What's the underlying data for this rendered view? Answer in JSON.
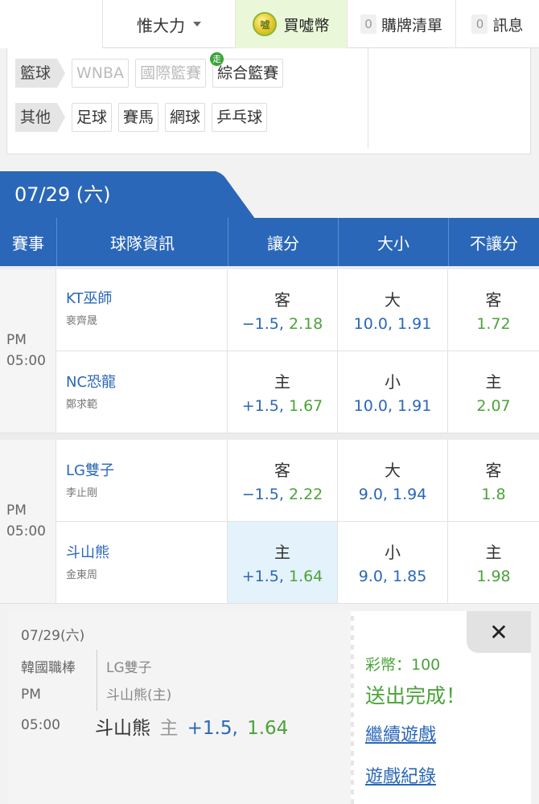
{
  "topbar": {
    "user_name": "惟大力",
    "coin_button_label": "買噓幣",
    "coin_icon_text": "噓",
    "cart_count": "0",
    "cart_label": "購牌清單",
    "msg_count": "0",
    "msg_label": "訊息"
  },
  "categories": {
    "rows": [
      {
        "label": "籃球",
        "items": [
          {
            "text": "WNBA",
            "dim": true
          },
          {
            "text": "國際籃賽",
            "dim": true
          },
          {
            "text": "綜合籃賽",
            "dim": false,
            "badge": "走"
          }
        ]
      },
      {
        "label": "其他",
        "items": [
          {
            "text": "足球",
            "dim": false
          },
          {
            "text": "賽馬",
            "dim": false
          },
          {
            "text": "網球",
            "dim": false
          },
          {
            "text": "乒乓球",
            "dim": false
          }
        ]
      }
    ]
  },
  "date_tab": "07/29 (六)",
  "headers": [
    "賽事",
    "球隊資訊",
    "讓分",
    "大小",
    "不讓分"
  ],
  "games": [
    {
      "time_ampm": "PM",
      "time": "05:00",
      "rows": [
        {
          "team": "KT巫師",
          "pitcher": "裵齊晟",
          "spread_side": "客",
          "spread_line": "−1.5,",
          "spread_odds": "2.18",
          "ou_side": "大",
          "ou_val": "10.0, 1.91",
          "ml_side": "客",
          "ml_val": "1.72"
        },
        {
          "team": "NC恐龍",
          "pitcher": "鄭求範",
          "spread_side": "主",
          "spread_line": "+1.5,",
          "spread_odds": "1.67",
          "ou_side": "小",
          "ou_val": "10.0, 1.91",
          "ml_side": "主",
          "ml_val": "2.07"
        }
      ]
    },
    {
      "time_ampm": "PM",
      "time": "05:00",
      "rows": [
        {
          "team": "LG雙子",
          "pitcher": "李止剛",
          "spread_side": "客",
          "spread_line": "−1.5,",
          "spread_odds": "2.22",
          "ou_side": "大",
          "ou_val": "9.0, 1.94",
          "ml_side": "客",
          "ml_val": "1.8"
        },
        {
          "team": "斗山熊",
          "pitcher": "金東周",
          "spread_side": "主",
          "spread_line": "+1.5,",
          "spread_odds": "1.64",
          "ou_side": "小",
          "ou_val": "9.0, 1.85",
          "ml_side": "主",
          "ml_val": "1.98"
        }
      ]
    }
  ],
  "popup": {
    "date": "07/29(六)",
    "league": "韓國職棒",
    "ampm": "PM",
    "time": "05:00",
    "away": "LG雙子",
    "home": "斗山熊(主)",
    "pick_team": "斗山熊",
    "pick_side": "主",
    "pick_line": "+1.5,",
    "pick_odds": "1.64",
    "close_label": "✕",
    "coins_text": "彩幣：100",
    "done_text": "送出完成！",
    "continue_link": "繼續遊戲",
    "history_link": "遊戲紀錄"
  },
  "colors": {
    "brand_blue": "#2a67b8",
    "odds_green": "#4ba33a",
    "coin_bg": "#eaf7d9",
    "selected_bg": "#e4f2fb"
  }
}
